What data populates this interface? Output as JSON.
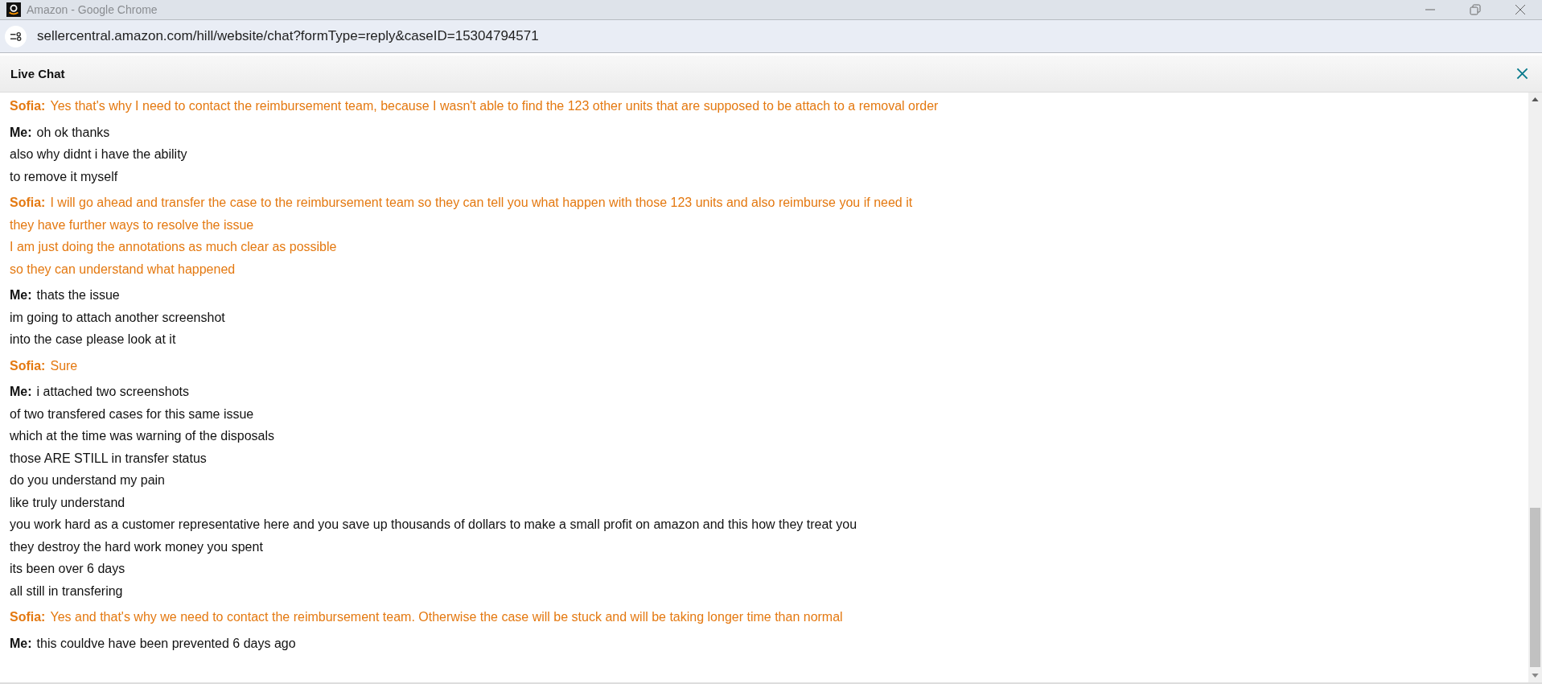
{
  "window": {
    "title": "Amazon - Google Chrome"
  },
  "address_bar": {
    "url": "sellercentral.amazon.com/hill/website/chat?formType=reply&caseID=15304794571"
  },
  "chat": {
    "title": "Live Chat",
    "messages": [
      {
        "kind": "agent",
        "sender": "Sofia:",
        "lines": [
          "Yes that's why I need to contact the reimbursement team, because I wasn't able to find the 123 other units that are supposed to be attach to a removal order"
        ]
      },
      {
        "kind": "me",
        "sender": "Me:",
        "lines": [
          "oh ok thanks",
          "also why didnt i have the ability",
          "to remove it myself"
        ]
      },
      {
        "kind": "agent",
        "sender": "Sofia:",
        "lines": [
          "I will go ahead and transfer the case to the reimbursement team so they can tell you what happen with those 123 units and also reimburse you if need it",
          "they have further ways to resolve the issue",
          "I am just doing the annotations as much clear as possible",
          "so they can understand what happened"
        ]
      },
      {
        "kind": "me",
        "sender": "Me:",
        "lines": [
          "thats the issue",
          "im going to attach another screenshot",
          "into the case please look at it"
        ]
      },
      {
        "kind": "agent",
        "sender": "Sofia:",
        "lines": [
          "Sure"
        ]
      },
      {
        "kind": "me",
        "sender": "Me:",
        "lines": [
          "i attached two screenshots",
          "of two transfered cases for this same issue",
          "which at the time was warning of the disposals",
          "those ARE STILL in transfer status",
          "do you understand my pain",
          "like truly understand",
          "you work hard as a customer representative here and you save up thousands of dollars to make a small profit on amazon and this how they treat you",
          "they destroy the hard work money you spent",
          "its been over 6 days",
          "all still in transfering"
        ]
      },
      {
        "kind": "agent",
        "sender": "Sofia:",
        "lines": [
          "Yes and that's why we need to contact the reimbursement team. Otherwise the case will be stuck and will be taking longer time than normal"
        ]
      },
      {
        "kind": "me",
        "sender": "Me:",
        "lines": [
          "this couldve have been prevented 6 days ago"
        ]
      }
    ]
  }
}
